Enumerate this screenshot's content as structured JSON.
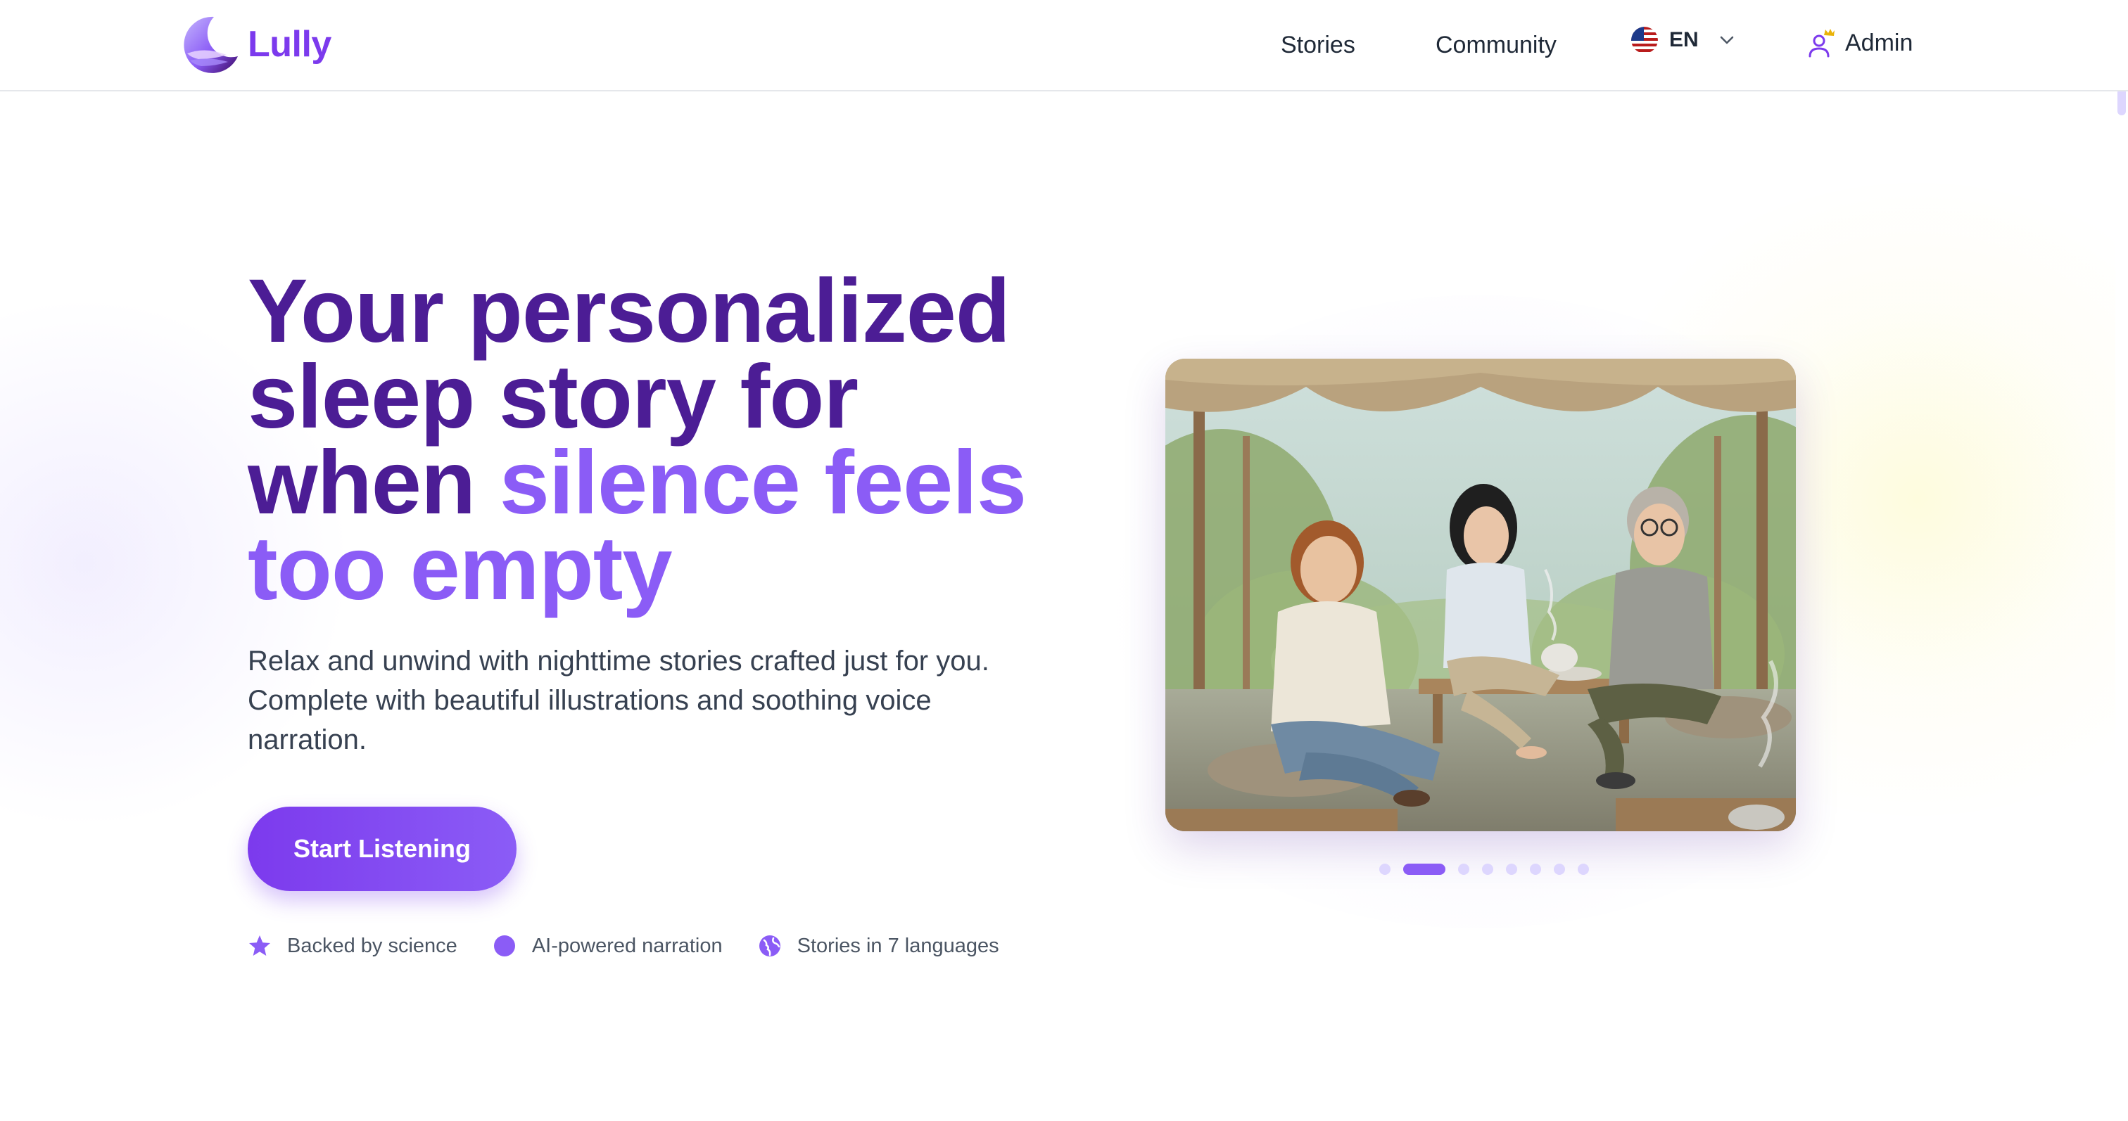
{
  "brand": {
    "name": "Lully",
    "accent": "#7c3aed",
    "accent_light": "#8b5cf6",
    "dark": "#4c1d95"
  },
  "nav": {
    "stories": "Stories",
    "community": "Community",
    "language": {
      "code": "EN",
      "flag_icon": "us-flag-icon",
      "dropdown_icon": "chevron-down-icon"
    },
    "admin": {
      "label": "Admin",
      "icon": "user-crown-icon"
    }
  },
  "hero": {
    "headline_line1": "Your personalized",
    "headline_line2": "sleep story for",
    "headline_line3_dark": "when ",
    "headline_line3_accent": "silence feels",
    "headline_line4_accent": "too empty",
    "subtitle": "Relax and unwind with nighttime stories crafted just for you. Complete with beautiful illustrations and soothing voice narration.",
    "cta": "Start Listening",
    "features": [
      {
        "icon": "star-icon",
        "label": "Backed by science"
      },
      {
        "icon": "circle-icon",
        "label": "AI-powered narration"
      },
      {
        "icon": "globe-icon",
        "label": "Stories in 7 languages"
      }
    ]
  },
  "carousel": {
    "image_description_icon": "illustration-image",
    "slide_count": 8,
    "active_slide": 2
  }
}
